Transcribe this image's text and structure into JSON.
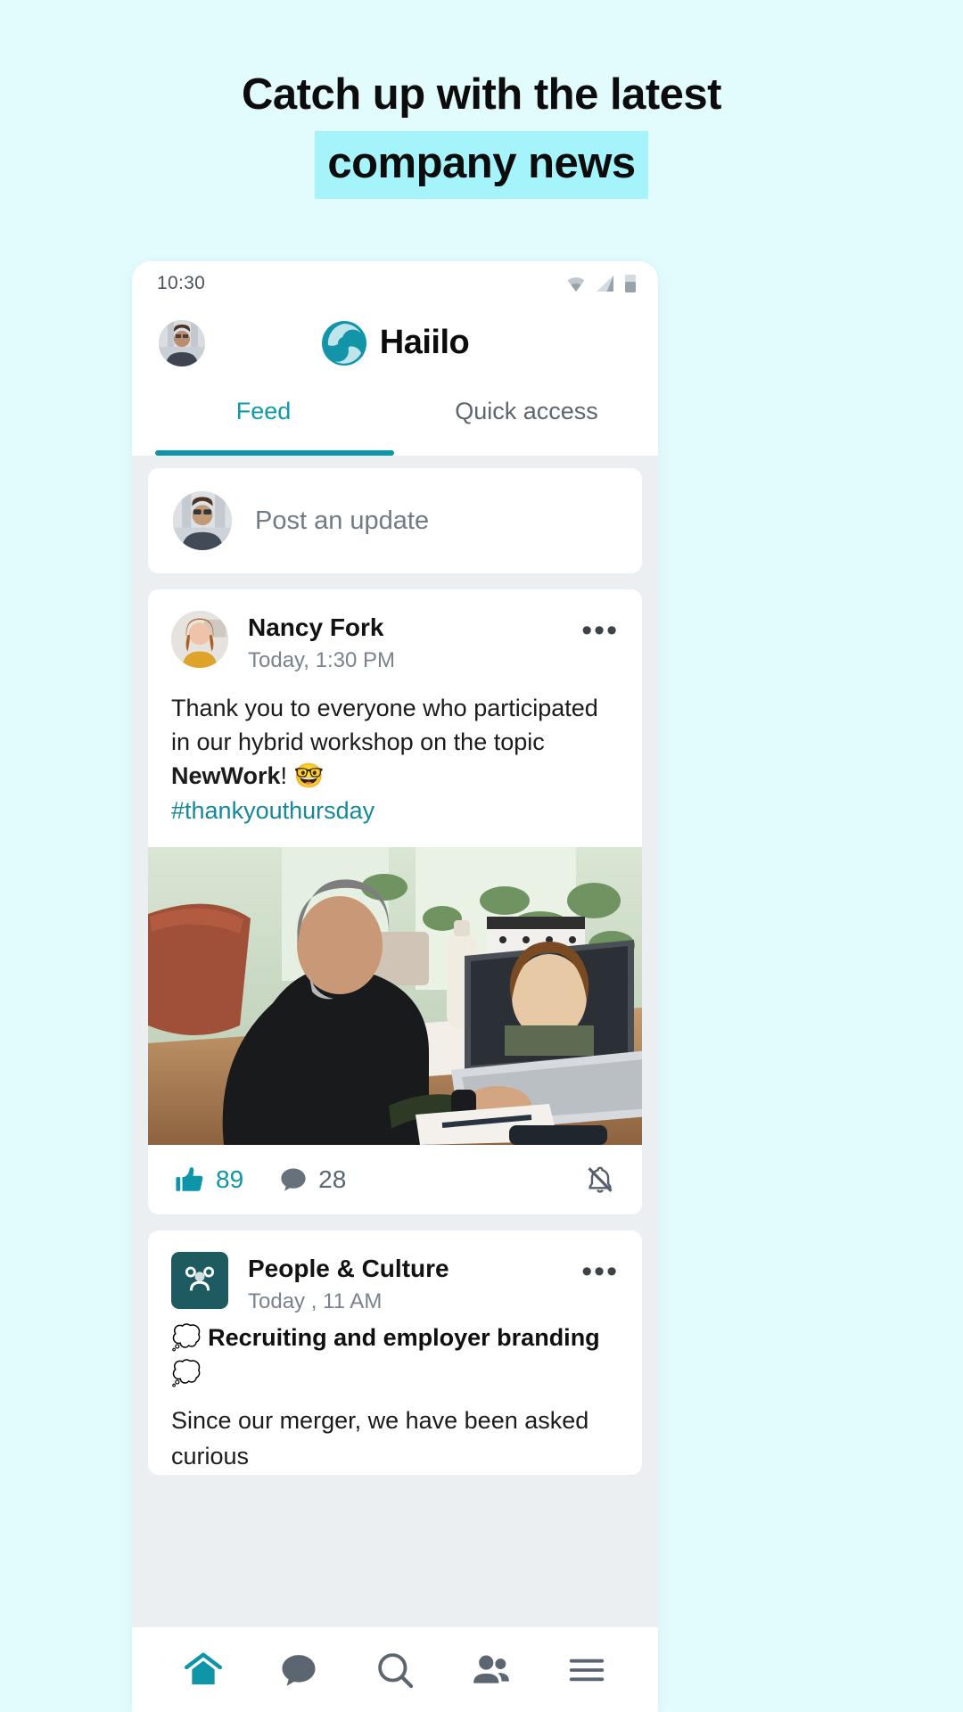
{
  "headline": {
    "line1": "Catch up with the latest",
    "line2": "company news",
    "highlight_color": "#a5f4fb"
  },
  "phone": {
    "statusbar": {
      "time": "10:30",
      "icons": [
        "wifi-icon",
        "cellular-signal-icon",
        "battery-icon"
      ]
    },
    "appbar": {
      "avatar_name": "user-avatar",
      "brand_name": "Haiilo",
      "brand_color": "#159cb0"
    },
    "tabs": [
      {
        "label": "Feed",
        "active": true
      },
      {
        "label": "Quick access",
        "active": false
      }
    ],
    "composer": {
      "placeholder": "Post an update"
    },
    "posts": [
      {
        "author": "Nancy Fork",
        "time": "Today, 1:30 PM",
        "more_label": "•••",
        "text_part1": "Thank you to everyone who participated in our hybrid workshop on the topic ",
        "text_bold": "NewWork",
        "text_part2": "! 🤓",
        "hashtag": "#thankyouthursday",
        "has_image": true,
        "likes": "89",
        "comments": "28",
        "like_icon": "thumbs-up-icon",
        "comment_icon": "comment-bubble-icon",
        "mute_icon": "bell-off-icon"
      },
      {
        "author": "People & Culture",
        "time": "Today , 11 AM",
        "more_label": "•••",
        "heading": "💭 Recruiting and employer branding 💭",
        "text": "Since our merger, we have been asked curious"
      }
    ],
    "bottomnav": [
      {
        "icon": "home-icon",
        "active": true
      },
      {
        "icon": "chat-bubble-icon",
        "active": false
      },
      {
        "icon": "search-icon",
        "active": false
      },
      {
        "icon": "people-icon",
        "active": false
      },
      {
        "icon": "menu-hamburger-icon",
        "active": false
      }
    ],
    "accent_color": "#0e95a8"
  }
}
